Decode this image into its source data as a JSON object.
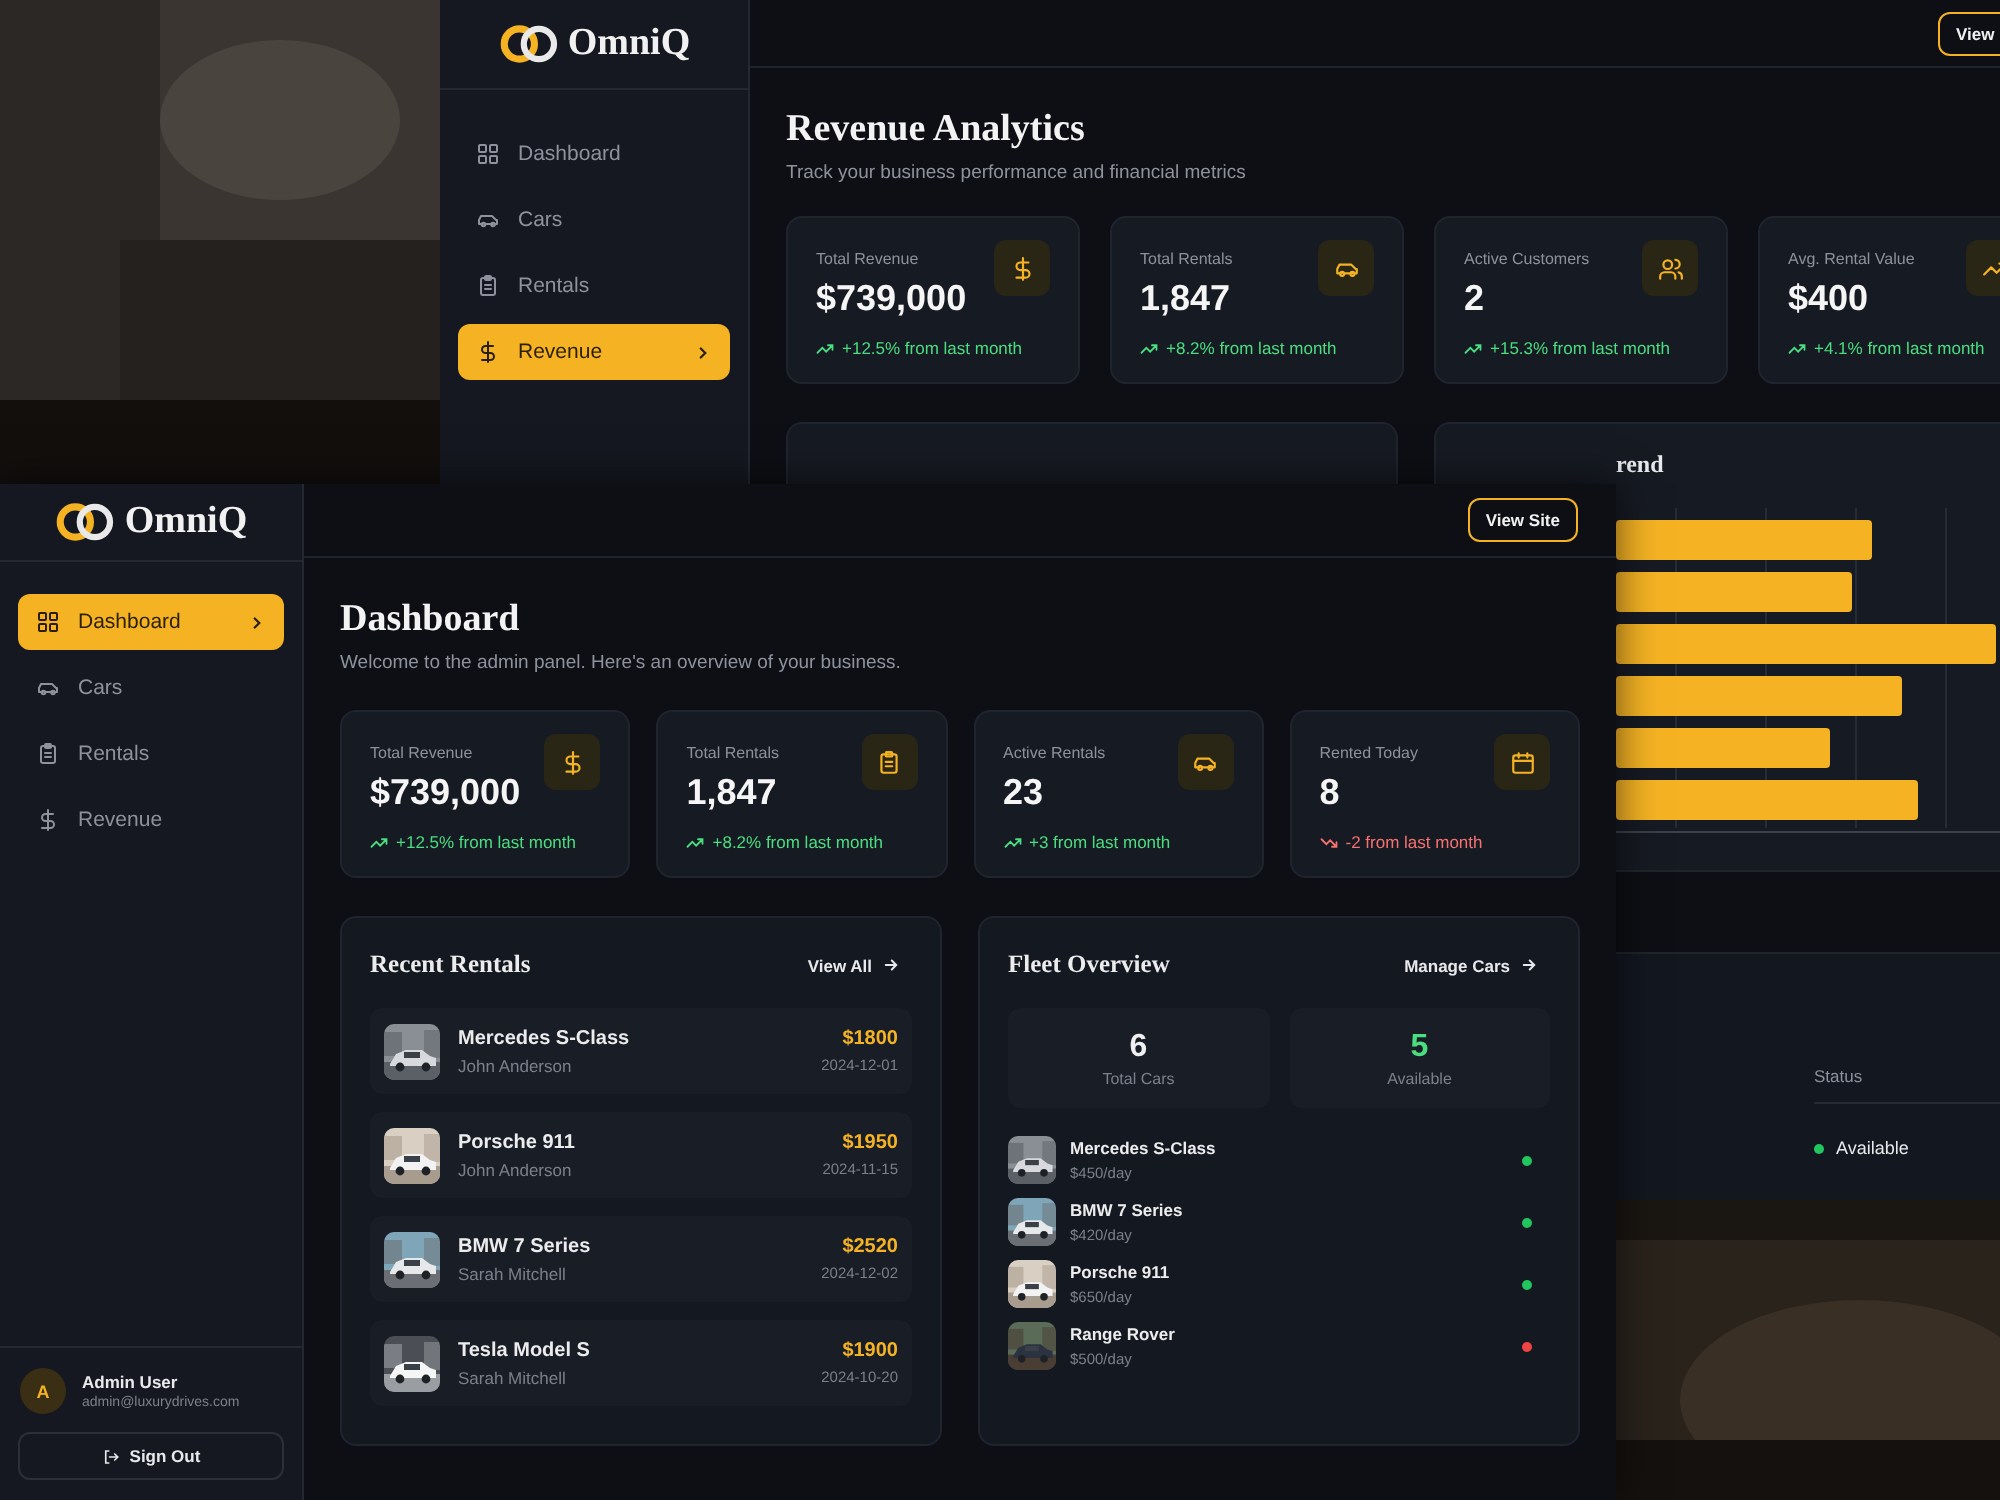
{
  "back_window": {
    "brand": "OmniQ",
    "header_button": "View",
    "nav": [
      {
        "label": "Dashboard",
        "selected": false
      },
      {
        "label": "Cars",
        "selected": false
      },
      {
        "label": "Rentals",
        "selected": false
      },
      {
        "label": "Revenue",
        "selected": true
      }
    ],
    "title": "Revenue Analytics",
    "subtitle": "Track your business performance and financial metrics",
    "stats": [
      {
        "label": "Total Revenue",
        "value": "$739,000",
        "change": "+12.5% from last month",
        "kind": "up"
      },
      {
        "label": "Total Rentals",
        "value": "1,847",
        "change": "+8.2% from last month",
        "kind": "up"
      },
      {
        "label": "Active Customers",
        "value": "2",
        "change": "+15.3% from last month",
        "kind": "up"
      },
      {
        "label": "Avg. Rental Value",
        "value": "$400",
        "change": "+4.1% from last month",
        "kind": "up"
      }
    ],
    "chart_title": "rend",
    "table": {
      "status_header": "Status",
      "rows": [
        {
          "status": "Available",
          "color": "#22c55e"
        }
      ]
    }
  },
  "front_window": {
    "brand": "OmniQ",
    "header_button": "View Site",
    "nav": [
      {
        "label": "Dashboard",
        "selected": true
      },
      {
        "label": "Cars",
        "selected": false
      },
      {
        "label": "Rentals",
        "selected": false
      },
      {
        "label": "Revenue",
        "selected": false
      }
    ],
    "title": "Dashboard",
    "subtitle": "Welcome to the admin panel. Here's an overview of your business.",
    "stats": [
      {
        "label": "Total Revenue",
        "value": "$739,000",
        "change": "+12.5% from last month",
        "kind": "up"
      },
      {
        "label": "Total Rentals",
        "value": "1,847",
        "change": "+8.2% from last month",
        "kind": "up"
      },
      {
        "label": "Active Rentals",
        "value": "23",
        "change": "+3 from last month",
        "kind": "up"
      },
      {
        "label": "Rented Today",
        "value": "8",
        "change": "-2 from last month",
        "kind": "down"
      }
    ],
    "recent_rentals": {
      "title": "Recent Rentals",
      "link": "View All",
      "items": [
        {
          "car": "Mercedes S-Class",
          "customer": "John Anderson",
          "price": "$1800",
          "date": "2024-12-01"
        },
        {
          "car": "Porsche 911",
          "customer": "John Anderson",
          "price": "$1950",
          "date": "2024-11-15"
        },
        {
          "car": "BMW 7 Series",
          "customer": "Sarah Mitchell",
          "price": "$2520",
          "date": "2024-12-02"
        },
        {
          "car": "Tesla Model S",
          "customer": "Sarah Mitchell",
          "price": "$1900",
          "date": "2024-10-20"
        }
      ]
    },
    "fleet": {
      "title": "Fleet Overview",
      "link": "Manage Cars",
      "totals": [
        {
          "value": "6",
          "label": "Total Cars",
          "kind": "neutral"
        },
        {
          "value": "5",
          "label": "Available",
          "kind": "positive"
        }
      ],
      "cars": [
        {
          "name": "Mercedes S-Class",
          "rate": "$450/day",
          "color": "#22c55e"
        },
        {
          "name": "BMW 7 Series",
          "rate": "$420/day",
          "color": "#22c55e"
        },
        {
          "name": "Porsche 911",
          "rate": "$650/day",
          "color": "#22c55e"
        },
        {
          "name": "Range Rover",
          "rate": "$500/day",
          "color": "#ef4444"
        }
      ]
    },
    "user": {
      "initial": "A",
      "name": "Admin User",
      "email": "admin@luxurydrives.com"
    },
    "sign_out": "Sign Out"
  }
}
